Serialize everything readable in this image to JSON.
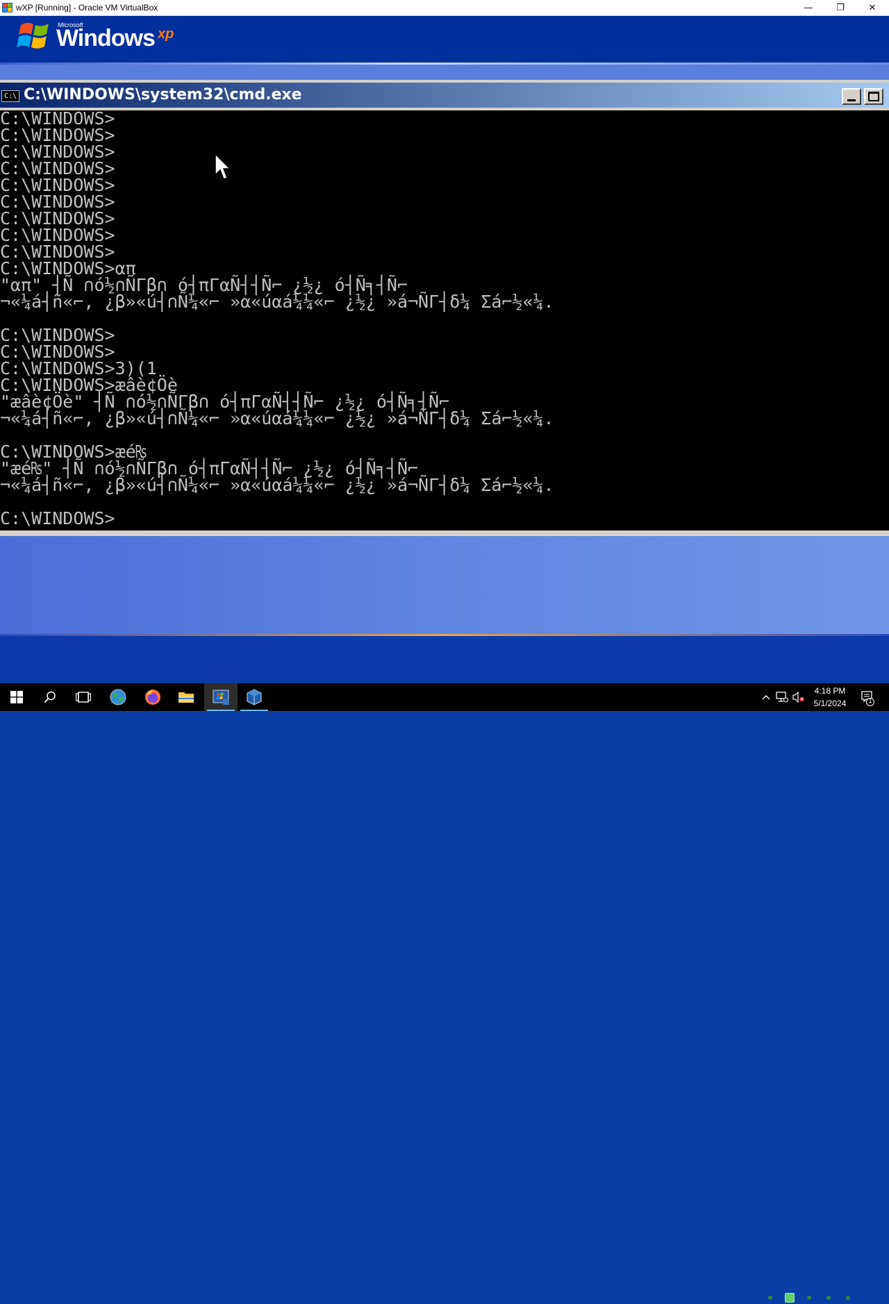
{
  "host_window": {
    "title": "wXP [Running] - Oracle VM VirtualBox",
    "minimize_glyph": "—",
    "restore_glyph": "❐",
    "close_glyph": "✕"
  },
  "xp_logo": {
    "microsoft": "Microsoft",
    "windows": "Windows",
    "xp": "xp"
  },
  "cmd": {
    "title": "C:\\WINDOWS\\system32\\cmd.exe",
    "icon_text": "C:\\",
    "lines": [
      "C:\\WINDOWS>",
      "C:\\WINDOWS>",
      "C:\\WINDOWS>",
      "C:\\WINDOWS>",
      "C:\\WINDOWS>",
      "C:\\WINDOWS>",
      "C:\\WINDOWS>",
      "C:\\WINDOWS>",
      "C:\\WINDOWS>",
      "C:\\WINDOWS>απ",
      "\"απ\" ┤Ñ ∩ó½∩ÑΓβ∩ ó┤πΓαÑ┤┤Ñ⌐ ¿½¿ ó┤Ñ╕┤Ñ⌐",
      "¬«¼á┤ñ«⌐, ¿β»«ú┤∩Ñ¼«⌐ »α«úαá¼¼«⌐ ¿½¿ »á¬ÑΓ┤δ¼ Σá⌐½«¼.",
      "",
      "C:\\WINDOWS>",
      "C:\\WINDOWS>",
      "C:\\WINDOWS>3)(1",
      "C:\\WINDOWS>æâè¢Öè",
      "\"æâè¢Öè\" ┤Ñ ∩ó½∩ÑΓβ∩ ó┤πΓαÑ┤┤Ñ⌐ ¿½¿ ó┤Ñ╕┤Ñ⌐",
      "¬«¼á┤ñ«⌐, ¿β»«ú┤∩Ñ¼«⌐ »α«úαá¼¼«⌐ ¿½¿ »á¬ÑΓ┤δ¼ Σá⌐½«¼.",
      "",
      "C:\\WINDOWS>æé₨",
      "\"æé₨\" ┤Ñ ∩ó½∩ÑΓβ∩ ó┤πΓαÑ┤┤Ñ⌐ ¿½¿ ó┤Ñ╕┤Ñ⌐",
      "¬«¼á┤ñ«⌐, ¿β»«ú┤∩Ñ¼«⌐ »α«úαá¼¼«⌐ ¿½¿ »á¬ÑΓ┤δ¼ Σá⌐½«¼.",
      "",
      "C:\\WINDOWS>"
    ]
  },
  "taskbar": {
    "items": [
      {
        "name": "start-button",
        "icon": "windows-logo-icon"
      },
      {
        "name": "search-button",
        "icon": "search-icon"
      },
      {
        "name": "task-view-button",
        "icon": "task-view-icon"
      },
      {
        "name": "taskbar-app-globe",
        "icon": "globe-icon"
      },
      {
        "name": "taskbar-app-firefox",
        "icon": "firefox-icon"
      },
      {
        "name": "taskbar-app-file-explorer",
        "icon": "folder-icon"
      },
      {
        "name": "taskbar-app-virtualbox-vm",
        "icon": "xp-window-icon",
        "active": true
      },
      {
        "name": "taskbar-app-virtualbox",
        "icon": "virtualbox-icon"
      }
    ],
    "time": "4:18 PM",
    "date": "5/1/2024",
    "notification_count": "1"
  },
  "colors": {
    "xp_blue_dark": "#00309c",
    "xp_blue_mid": "#5a7edc",
    "console_bg": "#000000",
    "console_text": "#c0c0c0"
  }
}
